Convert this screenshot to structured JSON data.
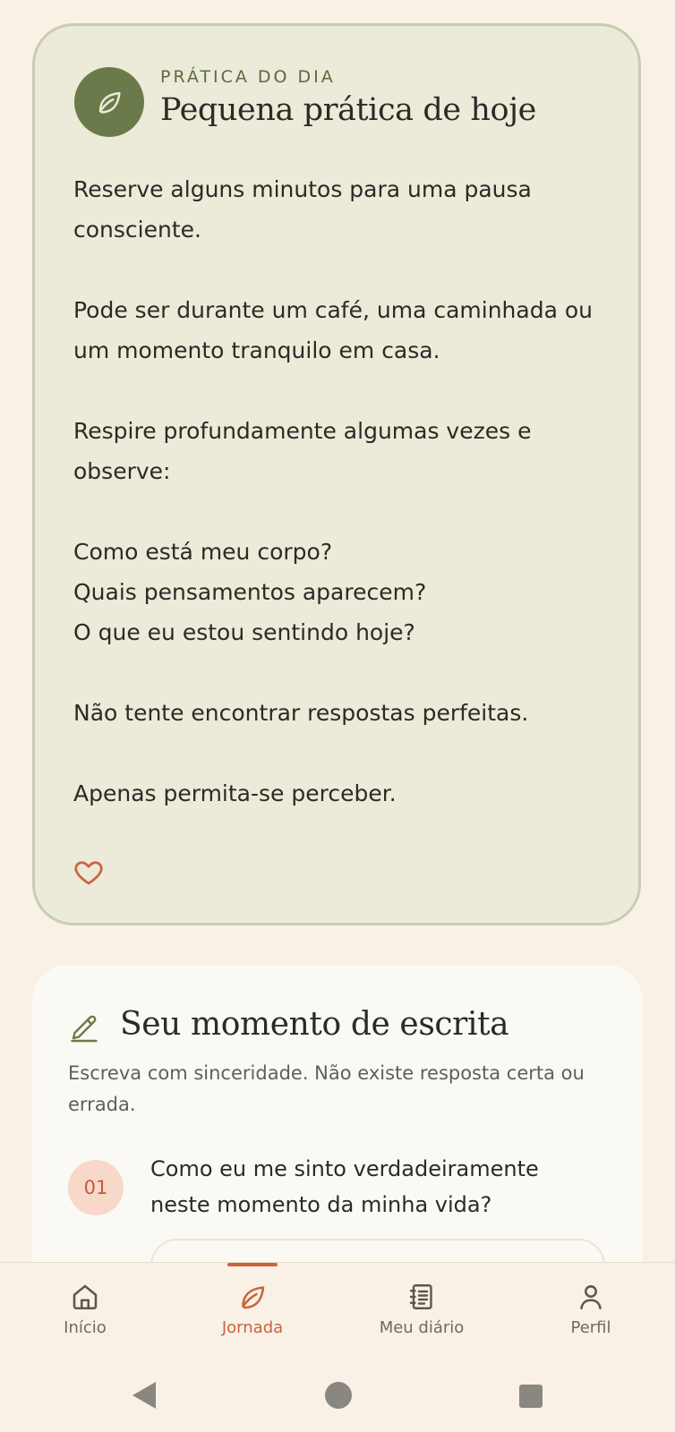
{
  "practice": {
    "eyebrow": "PRÁTICA DO DIA",
    "title": "Pequena prática de hoje",
    "paragraphs": [
      "Reserve alguns minutos para uma pausa consciente.",
      "Pode ser durante um café, uma caminhada ou um momento tranquilo em casa.",
      "Respire profundamente algumas vezes e observe:",
      "Como está meu corpo?",
      "Quais pensamentos aparecem?",
      "O que eu estou sentindo hoje?",
      "Não tente encontrar respostas perfeitas.",
      "Apenas permita-se perceber."
    ],
    "icon": "leaf-icon",
    "favorite_icon": "heart-icon"
  },
  "writing": {
    "title": "Seu momento de escrita",
    "subtitle": "Escreva com sinceridade. Não existe resposta certa ou errada.",
    "icon": "pencil-icon",
    "question": {
      "number": "01",
      "text": "Como eu me sinto verdadeiramente neste momento da minha vida?"
    }
  },
  "nav": {
    "items": [
      {
        "label": "Início",
        "icon": "home-icon"
      },
      {
        "label": "Jornada",
        "icon": "leaf-icon",
        "active": true
      },
      {
        "label": "Meu diário",
        "icon": "journal-icon"
      },
      {
        "label": "Perfil",
        "icon": "profile-icon"
      }
    ]
  },
  "colors": {
    "background": "#f9f1e5",
    "practice_card": "#ecead9",
    "accent_green": "#6b7a4a",
    "accent_orange": "#c8643f"
  }
}
